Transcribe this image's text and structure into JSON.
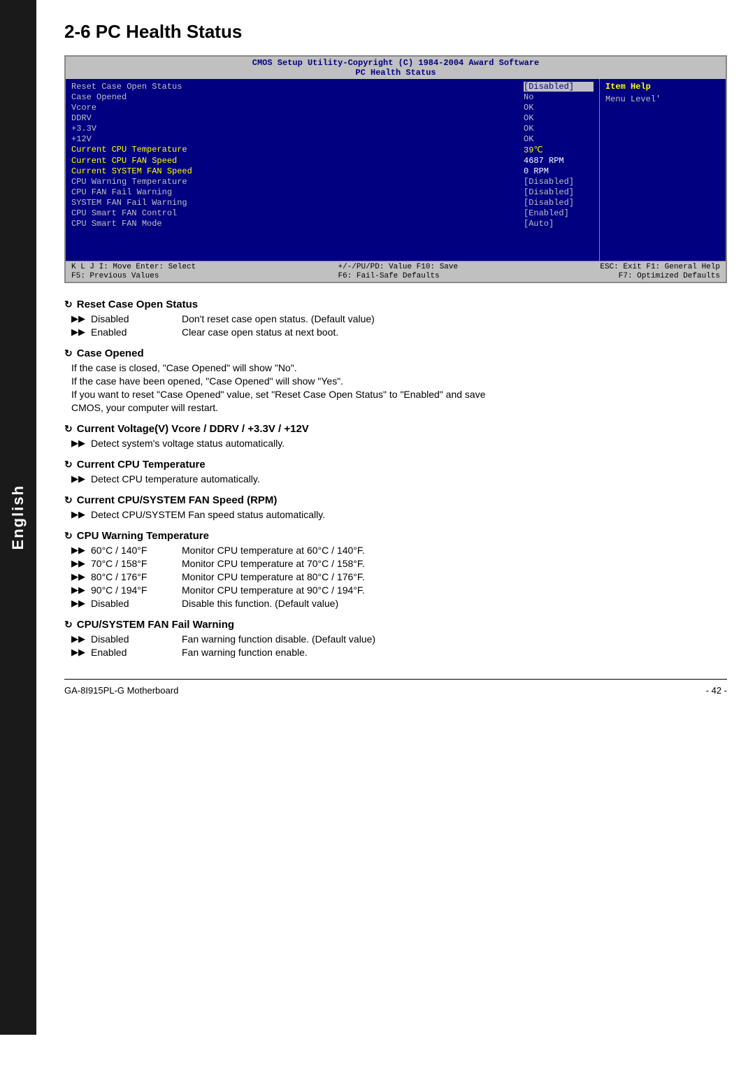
{
  "sidebar": {
    "label": "English"
  },
  "page": {
    "title": "2-6  PC Health Status"
  },
  "bios": {
    "header_line1": "CMOS Setup Utility-Copyright (C) 1984-2004 Award Software",
    "header_line2": "PC Health Status",
    "rows": [
      {
        "label": "Reset Case Open Status",
        "value": "[Disabled]",
        "highlight_label": false,
        "highlight_value": true
      },
      {
        "label": "Case Opened",
        "value": "No",
        "highlight_label": false,
        "highlight_value": false
      },
      {
        "label": "Vcore",
        "value": "OK",
        "highlight_label": false,
        "highlight_value": false
      },
      {
        "label": "DDRV",
        "value": "OK",
        "highlight_label": false,
        "highlight_value": false
      },
      {
        "label": "+3.3V",
        "value": "OK",
        "highlight_label": false,
        "highlight_value": false
      },
      {
        "label": "+12V",
        "value": "OK",
        "highlight_label": false,
        "highlight_value": false
      },
      {
        "label": "Current CPU Temperature",
        "value": "39℃",
        "highlight_label": true,
        "highlight_value": false,
        "value_yellow": true
      },
      {
        "label": "Current CPU FAN Speed",
        "value": "4687 RPM",
        "highlight_label": true,
        "highlight_value": false,
        "value_white": true
      },
      {
        "label": "Current SYSTEM FAN Speed",
        "value": "0    RPM",
        "highlight_label": true,
        "highlight_value": false,
        "value_white": true
      },
      {
        "label": "CPU Warning Temperature",
        "value": "[Disabled]",
        "highlight_label": false,
        "highlight_value": false
      },
      {
        "label": "CPU FAN Fail Warning",
        "value": "[Disabled]",
        "highlight_label": false,
        "highlight_value": false
      },
      {
        "label": "SYSTEM FAN Fail Warning",
        "value": "[Disabled]",
        "highlight_label": false,
        "highlight_value": false
      },
      {
        "label": "CPU Smart FAN Control",
        "value": "[Enabled]",
        "highlight_label": false,
        "highlight_value": false
      },
      {
        "label": "CPU Smart FAN Mode",
        "value": "[Auto]",
        "highlight_label": false,
        "highlight_value": false
      }
    ],
    "item_help_title": "Item Help",
    "item_help_text": "Menu Level'",
    "footer": {
      "col1": "K L J I: Move    Enter: Select",
      "col2": "+/-/PU/PD: Value    F10: Save",
      "col3": "ESC: Exit    F1: General Help",
      "col4": "F5: Previous Values",
      "col5": "F6: Fail-Safe Defaults",
      "col6": "F7: Optimized Defaults"
    }
  },
  "sections": [
    {
      "id": "reset-case",
      "title": "Reset Case Open Status",
      "items": [
        {
          "arrow": "▶▶",
          "name": "Disabled",
          "desc": "Don't reset case open status. (Default value)"
        },
        {
          "arrow": "▶▶",
          "name": "Enabled",
          "desc": "Clear case open status at next boot."
        }
      ],
      "paragraphs": []
    },
    {
      "id": "case-opened",
      "title": "Case Opened",
      "items": [],
      "paragraphs": [
        "If the case is closed, \"Case Opened\" will show \"No\".",
        "If the case have been opened, \"Case Opened\" will show \"Yes\".",
        "If you want to reset \"Case Opened\" value, set \"Reset Case Open Status\" to \"Enabled\" and save",
        "CMOS, your computer will restart."
      ]
    },
    {
      "id": "current-voltage",
      "title": "Current Voltage(V) Vcore / DDRV / +3.3V / +12V",
      "items": [
        {
          "arrow": "▶▶",
          "name": "",
          "desc": "Detect system's voltage status automatically."
        }
      ],
      "paragraphs": []
    },
    {
      "id": "current-cpu-temp",
      "title": "Current CPU Temperature",
      "items": [
        {
          "arrow": "▶▶",
          "name": "",
          "desc": "Detect CPU temperature automatically."
        }
      ],
      "paragraphs": []
    },
    {
      "id": "current-fan-speed",
      "title": "Current CPU/SYSTEM FAN Speed (RPM)",
      "items": [
        {
          "arrow": "▶▶",
          "name": "",
          "desc": "Detect CPU/SYSTEM Fan speed status automatically."
        }
      ],
      "paragraphs": []
    },
    {
      "id": "cpu-warning-temp",
      "title": "CPU Warning Temperature",
      "items": [
        {
          "arrow": "▶▶",
          "name": "60°C / 140°F",
          "desc": "Monitor CPU temperature at 60°C / 140°F."
        },
        {
          "arrow": "▶▶",
          "name": "70°C / 158°F",
          "desc": "Monitor CPU temperature at 70°C / 158°F."
        },
        {
          "arrow": "▶▶",
          "name": "80°C / 176°F",
          "desc": "Monitor CPU temperature at 80°C / 176°F."
        },
        {
          "arrow": "▶▶",
          "name": "90°C / 194°F",
          "desc": "Monitor CPU temperature at 90°C / 194°F."
        },
        {
          "arrow": "▶▶",
          "name": "Disabled",
          "desc": "Disable this function. (Default value)"
        }
      ],
      "paragraphs": []
    },
    {
      "id": "fan-fail-warning",
      "title": "CPU/SYSTEM FAN Fail Warning",
      "items": [
        {
          "arrow": "▶▶",
          "name": "Disabled",
          "desc": "Fan warning function disable. (Default value)"
        },
        {
          "arrow": "▶▶",
          "name": "Enabled",
          "desc": "Fan warning function enable."
        }
      ],
      "paragraphs": []
    }
  ],
  "footer": {
    "model": "GA-8I915PL-G Motherboard",
    "page": "- 42 -"
  }
}
